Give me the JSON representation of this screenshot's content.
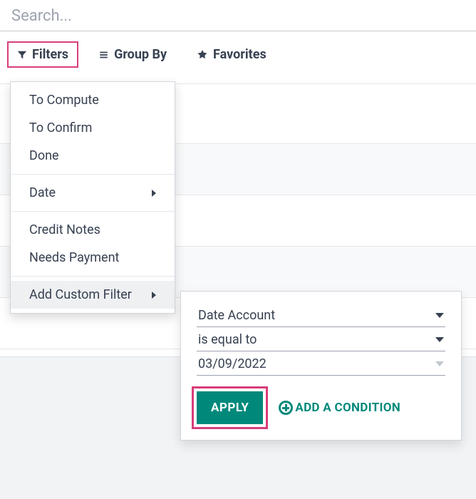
{
  "search": {
    "placeholder": "Search..."
  },
  "toolbar": {
    "filters_label": "Filters",
    "groupby_label": "Group By",
    "favorites_label": "Favorites"
  },
  "filters_menu": {
    "items_a": [
      "To Compute",
      "To Confirm",
      "Done"
    ],
    "date_label": "Date",
    "items_b": [
      "Credit Notes",
      "Needs Payment"
    ],
    "add_custom_label": "Add Custom Filter"
  },
  "custom_filter": {
    "field": "Date Account",
    "operator": "is equal to",
    "value": "03/09/2022",
    "apply_label": "APPLY",
    "add_condition_label": "ADD A CONDITION"
  }
}
